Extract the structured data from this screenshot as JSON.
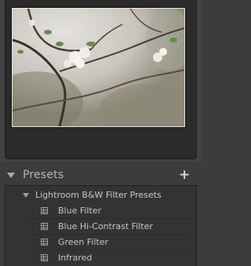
{
  "presets": {
    "title": "Presets",
    "add_button": "+",
    "folder": {
      "label": "Lightroom B&W Filter Presets"
    },
    "items": [
      {
        "label": "Blue Filter"
      },
      {
        "label": "Blue Hi-Contrast Filter"
      },
      {
        "label": "Green Filter"
      },
      {
        "label": "Infrared"
      }
    ]
  },
  "colors": {
    "panel_bg": "#3c3c3c",
    "list_bg": "#333333",
    "text": "#c6c6c6",
    "photo_frame": "#e6e6e6"
  },
  "icons": {
    "collapse": "triangle-down-icon",
    "add": "plus-icon",
    "preset": "preset-icon"
  }
}
